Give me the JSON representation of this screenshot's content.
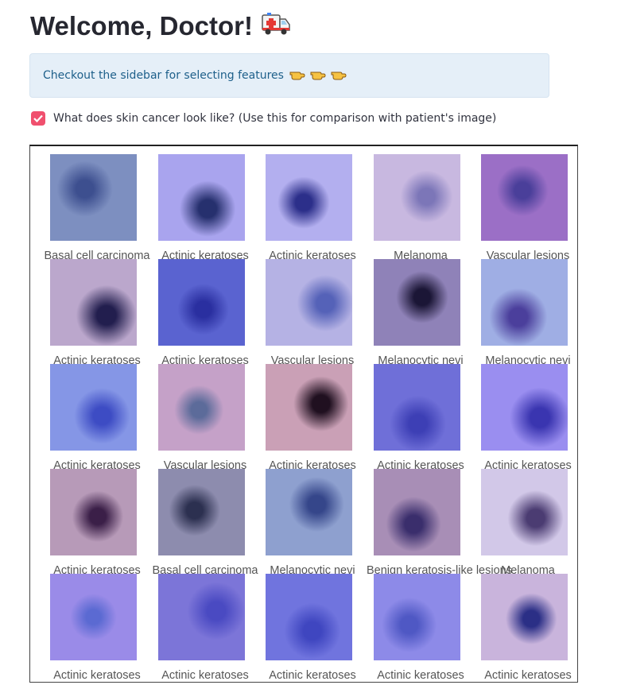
{
  "header": {
    "title": "Welcome, Doctor!",
    "title_icon": "ambulance-icon"
  },
  "info": {
    "text": "Checkout the sidebar for selecting features",
    "icon": "pointing-hand-icon"
  },
  "compare_checkbox": {
    "checked": true,
    "label": "What does skin cancer look like? (Use this for comparison with patient's image)",
    "color": "#f0506e"
  },
  "gallery": {
    "rows": [
      [
        "Basal cell carcinoma",
        "Actinic keratoses",
        "Actinic keratoses",
        "Melanoma",
        "Vascular lesions"
      ],
      [
        "Actinic keratoses",
        "Actinic keratoses",
        "Vascular lesions",
        "Melanocytic nevi",
        "Melanocytic nevi"
      ],
      [
        "Actinic keratoses",
        "Vascular lesions",
        "Actinic keratoses",
        "Actinic keratoses",
        "Actinic keratoses"
      ],
      [
        "Actinic keratoses",
        "Basal cell carcinoma",
        "Melanocytic nevi",
        "Benign keratosis-like lesions",
        "Melanoma"
      ],
      [
        "Actinic keratoses",
        "Actinic keratoses",
        "Actinic keratoses",
        "Actinic keratoses",
        "Actinic keratoses"
      ]
    ]
  }
}
